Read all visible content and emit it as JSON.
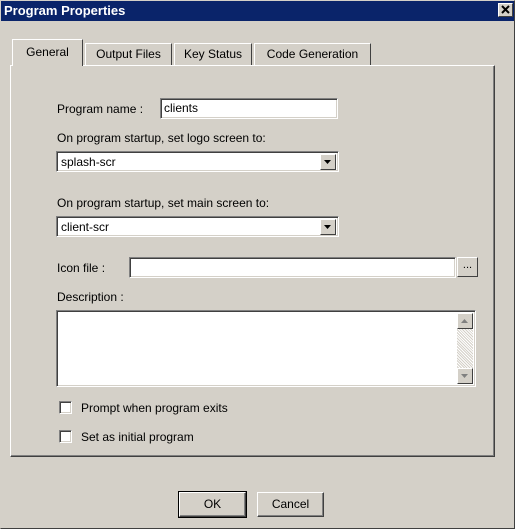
{
  "window": {
    "title": "Program Properties"
  },
  "tabs": [
    {
      "label": "General",
      "active": true
    },
    {
      "label": "Output Files",
      "active": false
    },
    {
      "label": "Key Status",
      "active": false
    },
    {
      "label": "Code Generation",
      "active": false
    }
  ],
  "general": {
    "program_name_label": "Program name :",
    "program_name_value": "clients",
    "logo_screen_label": "On program startup, set logo screen to:",
    "logo_screen_value": "splash-scr",
    "main_screen_label": "On program startup, set main screen to:",
    "main_screen_value": "client-scr",
    "icon_file_label": "Icon file :",
    "icon_file_value": "",
    "browse_label": "...",
    "description_label": "Description :",
    "description_value": "",
    "prompt_exit_label": "Prompt when program exits",
    "prompt_exit_checked": false,
    "initial_program_label": "Set as initial program",
    "initial_program_checked": false
  },
  "buttons": {
    "ok_label": "OK",
    "cancel_label": "Cancel"
  },
  "colors": {
    "titlebar": "#0a246a",
    "face": "#d4d0c8"
  },
  "icons": [
    "close-icon",
    "dropdown-arrow-icon",
    "scroll-up-icon",
    "scroll-down-icon"
  ]
}
